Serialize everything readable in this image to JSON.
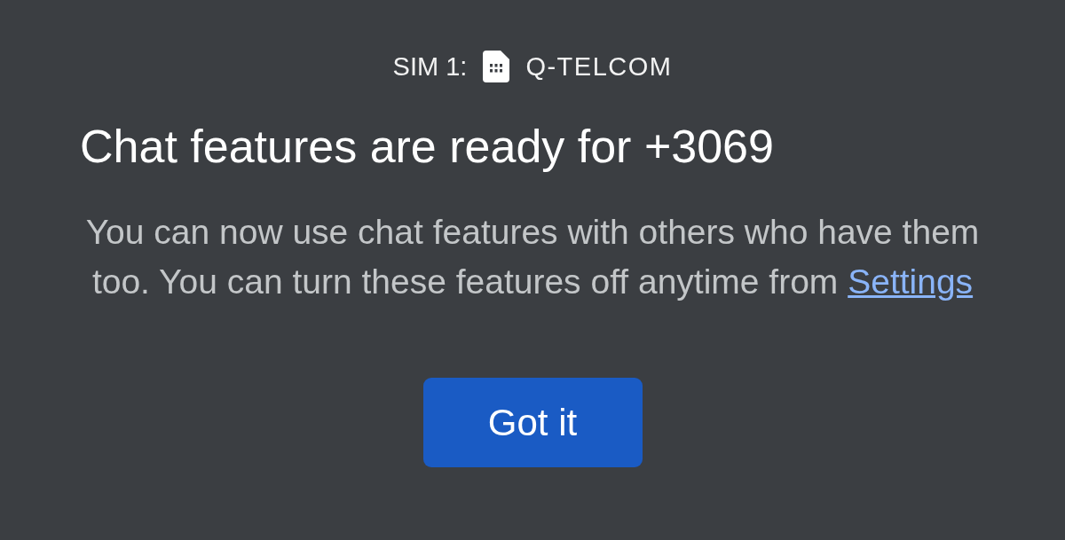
{
  "carrier": {
    "sim_label": "SIM 1:",
    "name": "Q-TELCOM"
  },
  "title": "Chat features are ready for +3069",
  "message": {
    "text": "You can now use chat features with others who have them too. You can turn these features off anytime from",
    "link": "Settings"
  },
  "buttons": [
    {
      "label": "Got it",
      "kind": "primary"
    }
  ]
}
